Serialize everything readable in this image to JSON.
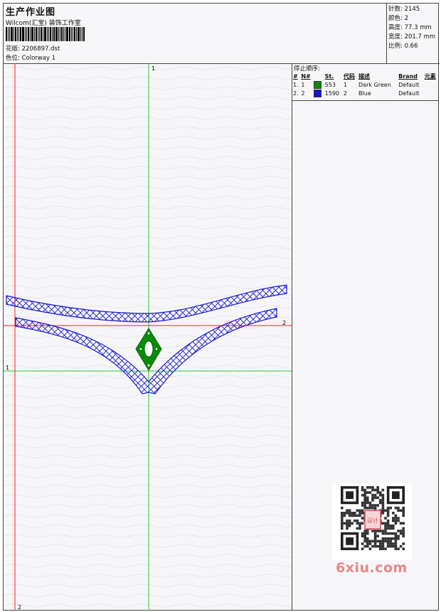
{
  "header": {
    "title": "生产作业图",
    "company": "Wilcom(汇宝) 装饰工作室",
    "design_label": "花版:",
    "design_value": "2206897.dst",
    "color_label": "色位:",
    "color_value": "Colorway 1"
  },
  "stats": {
    "stitches": "针数: 2145",
    "colors": "颜色: 2",
    "height": "高度: 77.3 mm",
    "width": "宽度: 201.7 mm",
    "scale": "比例: 0.66"
  },
  "stop_sequence": {
    "title": "停止顺序:",
    "columns": [
      "#",
      "N#",
      "St.",
      "代码",
      "描述",
      "Brand",
      "元素"
    ],
    "rows": [
      {
        "idx": "1.",
        "n": "1",
        "color": "#0a8a0a",
        "stitches": "553",
        "code": "1",
        "desc": "Dark Green",
        "brand": "Default"
      },
      {
        "idx": "2.",
        "n": "2",
        "color": "#1414d8",
        "stitches": "1590",
        "code": "2",
        "desc": "Blue",
        "brand": "Default"
      }
    ]
  },
  "axes": {
    "green_top": "1",
    "green_left": "1",
    "red_right": "2",
    "red_bottom": "2"
  },
  "watermark": {
    "site": "6xiu.com",
    "stamp": "设计"
  },
  "colors": {
    "green_axis": "#22cc22",
    "red_axis": "#ee2222",
    "thread_blue": "#1a1ad0",
    "thread_green": "#0a8a0a",
    "brand_pink": "#e8868d"
  }
}
